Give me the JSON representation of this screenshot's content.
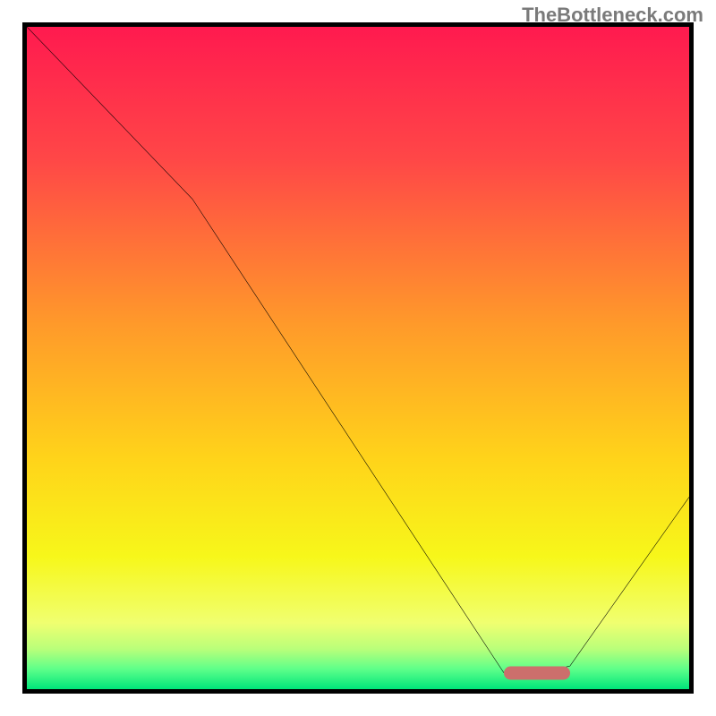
{
  "watermark": "TheBottleneck.com",
  "chart_data": {
    "type": "line",
    "title": "",
    "xlabel": "",
    "ylabel": "",
    "xlim": [
      0,
      100
    ],
    "ylim": [
      0,
      100
    ],
    "x": [
      0,
      25,
      72,
      78,
      82,
      100
    ],
    "values": [
      100,
      74,
      2.5,
      2.5,
      3.5,
      29
    ],
    "marker": {
      "x_start": 72,
      "x_end": 82,
      "y": 2.5
    },
    "gradient_stops": [
      {
        "offset": 0,
        "color": "#ff1a4f"
      },
      {
        "offset": 20,
        "color": "#ff4747"
      },
      {
        "offset": 45,
        "color": "#ff9a2a"
      },
      {
        "offset": 65,
        "color": "#ffd31a"
      },
      {
        "offset": 80,
        "color": "#f7f71a"
      },
      {
        "offset": 90,
        "color": "#f0ff70"
      },
      {
        "offset": 94,
        "color": "#b8ff7a"
      },
      {
        "offset": 97,
        "color": "#5dff8a"
      },
      {
        "offset": 100,
        "color": "#00e57a"
      }
    ]
  }
}
